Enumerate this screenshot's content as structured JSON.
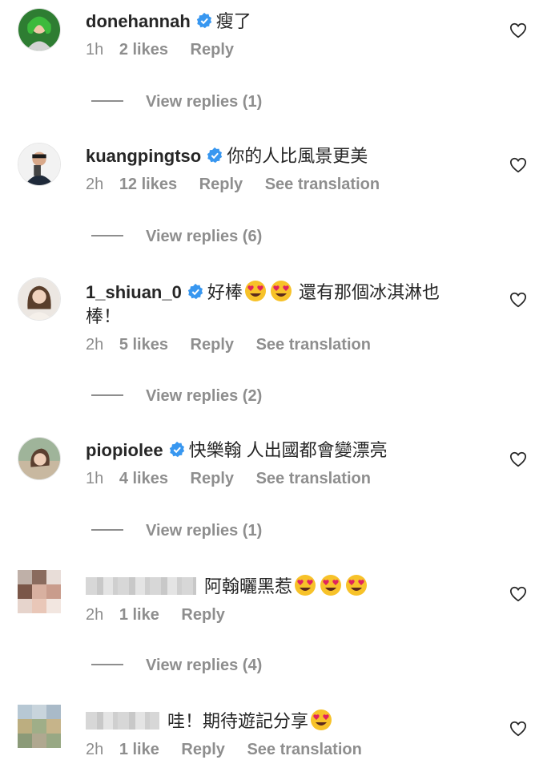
{
  "comments": [
    {
      "username": "donehannah",
      "verified": true,
      "text": "瘦了",
      "time": "1h",
      "likes": "2 likes",
      "reply": "Reply",
      "translation": "",
      "view_replies": "View replies (1)"
    },
    {
      "username": "kuangpingtso",
      "verified": true,
      "text": "你的人比風景更美",
      "time": "2h",
      "likes": "12 likes",
      "reply": "Reply",
      "translation": "See translation",
      "view_replies": "View replies (6)"
    },
    {
      "username": "1_shiuan_0",
      "verified": true,
      "text_a": "好棒",
      "text_b": "還有那個冰淇淋也",
      "text_c": "棒！",
      "time": "2h",
      "likes": "5 likes",
      "reply": "Reply",
      "translation": "See translation",
      "view_replies": "View replies (2)"
    },
    {
      "username": "piopiolee",
      "verified": true,
      "text": "快樂翰 人出國都會變漂亮",
      "time": "1h",
      "likes": "4 likes",
      "reply": "Reply",
      "translation": "See translation",
      "view_replies": "View replies (1)"
    },
    {
      "username": "",
      "verified": false,
      "text": "阿翰曬黑惹",
      "time": "2h",
      "likes": "1 like",
      "reply": "Reply",
      "translation": "",
      "view_replies": "View replies (4)"
    },
    {
      "username": "",
      "verified": false,
      "text": "哇！期待遊記分享",
      "time": "2h",
      "likes": "1 like",
      "reply": "Reply",
      "translation": "See translation",
      "view_replies": ""
    }
  ],
  "icons": {
    "heart": "heart-outline-icon",
    "verified": "verified-badge-icon",
    "emoji": "heart-eyes-emoji-icon"
  },
  "colors": {
    "verified": "#3897f0",
    "meta": "#8e8e8e",
    "text": "#262626",
    "emoji_face": "#f7c229",
    "emoji_heart": "#e0245e"
  }
}
